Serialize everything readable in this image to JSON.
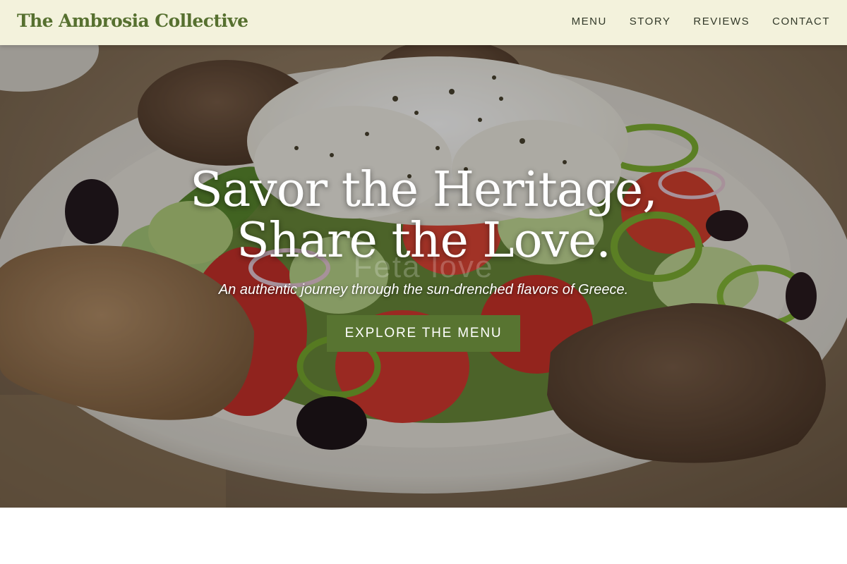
{
  "header": {
    "brand": "The Ambrosia Collective",
    "nav": [
      {
        "label": "MENU"
      },
      {
        "label": "STORY"
      },
      {
        "label": "REVIEWS"
      },
      {
        "label": "CONTACT"
      }
    ]
  },
  "hero": {
    "title_line1": "Savor the Heritage,",
    "title_line2": "Share the Love.",
    "subtitle": "An authentic journey through the sun-drenched flavors of Greece.",
    "cta_label": "EXPLORE THE MENU",
    "watermark": "Feta love",
    "image_subject": "greek-salad-plate"
  },
  "colors": {
    "accent": "#587431",
    "brand_text": "#56702f",
    "header_bg": "#f3f2dc"
  }
}
